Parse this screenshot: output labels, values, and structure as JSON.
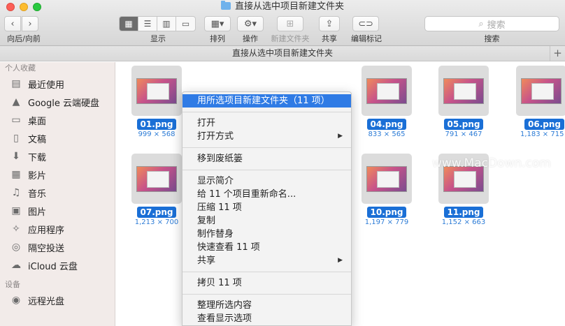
{
  "window": {
    "title": "直接从选中项目新建文件夹"
  },
  "toolbar": {
    "nav_label": "向后/向前",
    "view_label": "显示",
    "arrange_label": "排列",
    "action_label": "操作",
    "new_folder_label": "新建文件夹",
    "share_label": "共享",
    "tags_label": "编辑标记",
    "search_label": "搜索",
    "search_placeholder": "搜索"
  },
  "pathbar": {
    "title": "直接从选中项目新建文件夹"
  },
  "sidebar": {
    "favorites_header": "个人收藏",
    "items": [
      {
        "label": "最近使用",
        "icon": "recents-icon"
      },
      {
        "label": "Google 云端硬盘",
        "icon": "google-drive-icon"
      },
      {
        "label": "桌面",
        "icon": "desktop-icon"
      },
      {
        "label": "文稿",
        "icon": "documents-icon"
      },
      {
        "label": "下载",
        "icon": "downloads-icon"
      },
      {
        "label": "影片",
        "icon": "movies-icon"
      },
      {
        "label": "音乐",
        "icon": "music-icon"
      },
      {
        "label": "图片",
        "icon": "pictures-icon"
      },
      {
        "label": "应用程序",
        "icon": "applications-icon"
      },
      {
        "label": "隔空投送",
        "icon": "airdrop-icon"
      },
      {
        "label": "iCloud 云盘",
        "icon": "icloud-icon"
      }
    ],
    "devices_header": "设备",
    "devices": [
      {
        "label": "远程光盘",
        "icon": "remote-disc-icon"
      }
    ]
  },
  "files": [
    {
      "name": "01.png",
      "dims": "999 × 568"
    },
    {
      "name": "04.png",
      "dims": "833 × 565"
    },
    {
      "name": "05.png",
      "dims": "791 × 467"
    },
    {
      "name": "06.png",
      "dims": "1,183 × 715"
    },
    {
      "name": "07.png",
      "dims": "1,213 × 700"
    },
    {
      "name": "10.png",
      "dims": "1,197 × 779"
    },
    {
      "name": "11.png",
      "dims": "1,152 × 663"
    }
  ],
  "context_menu": {
    "items": [
      "用所选项目新建文件夹（11 项）",
      "打开",
      "打开方式",
      "移到废纸篓",
      "显示简介",
      "给 11 个项目重新命名...",
      "压缩 11 项",
      "复制",
      "制作替身",
      "快速查看 11 项",
      "共享",
      "拷贝 11 项",
      "整理所选内容",
      "查看显示选项"
    ]
  },
  "watermark": {
    "text": "www.MacDown.com"
  }
}
